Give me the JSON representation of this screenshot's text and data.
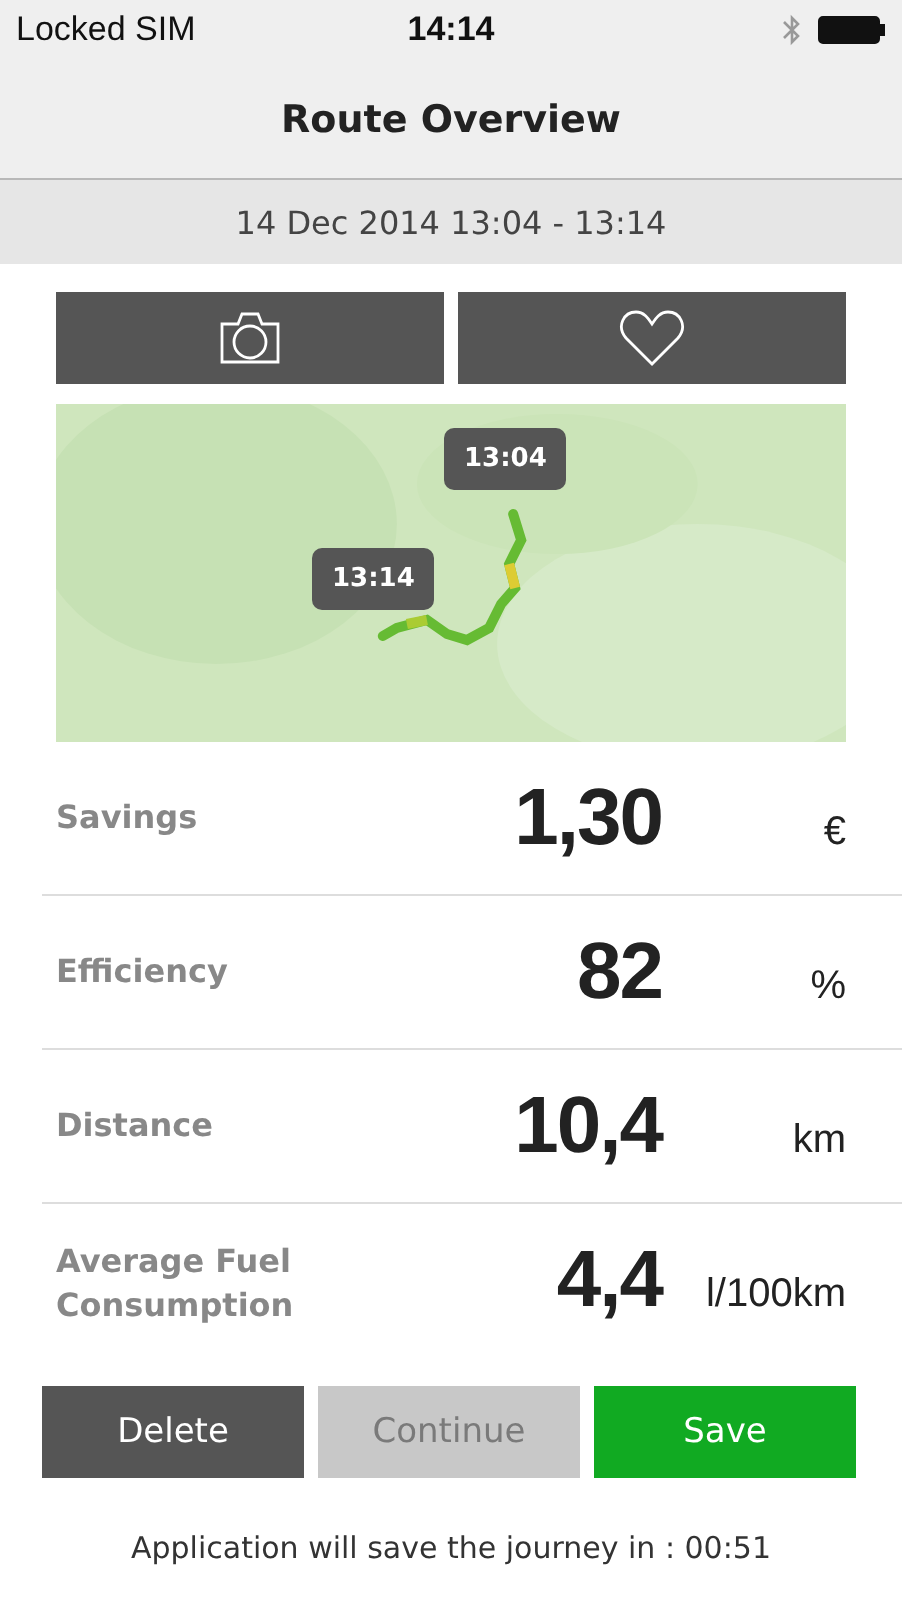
{
  "status_bar": {
    "carrier": "Locked SIM",
    "time": "14:14"
  },
  "header": {
    "title": "Route Overview"
  },
  "date_range": "14 Dec 2014 13:04 - 13:14",
  "map": {
    "kind": "picture",
    "markers": [
      {
        "label": "13:04"
      },
      {
        "label": "13:14"
      }
    ]
  },
  "stats": [
    {
      "label": "Savings",
      "value": "1,30",
      "unit": "€"
    },
    {
      "label": "Efficiency",
      "value": "82",
      "unit": "%"
    },
    {
      "label": "Distance",
      "value": "10,4",
      "unit": "km"
    },
    {
      "label": "Average Fuel Consumption",
      "value": "4,4",
      "unit": "l/100km"
    }
  ],
  "buttons": [
    {
      "label": "Delete",
      "kind": "neutral",
      "disabled": false
    },
    {
      "label": "Continue",
      "kind": "neutral",
      "disabled": true
    },
    {
      "label": "Save",
      "kind": "primary",
      "disabled": false
    }
  ],
  "footer": "Application will save the journey in : 00:51"
}
